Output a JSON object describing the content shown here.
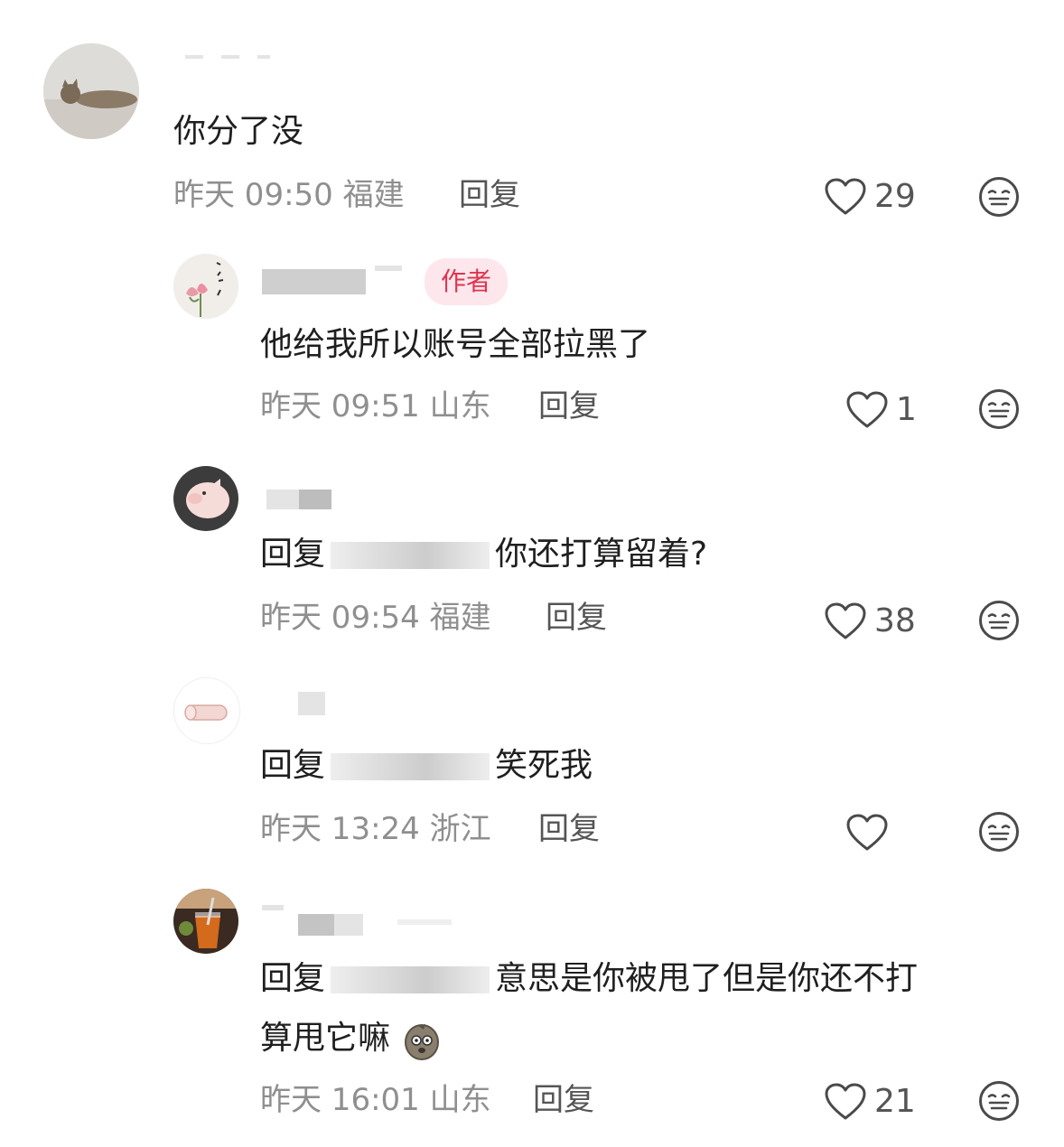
{
  "comments": [
    {
      "text": "你分了没",
      "meta": "昨天 09:50 福建",
      "reply_label": "回复",
      "likes": "29",
      "avatar_icon": "cat-avatar-icon"
    },
    {
      "author_tag": "作者",
      "text": "他给我所以账号全部拉黑了",
      "meta": "昨天 09:51 山东",
      "reply_label": "回复",
      "likes": "1",
      "avatar_icon": "flower-avatar-icon"
    },
    {
      "reply_prefix": "回复",
      "text": "你还打算留着?",
      "meta": "昨天 09:54 福建",
      "reply_label": "回复",
      "likes": "38",
      "avatar_icon": "pig-avatar-icon"
    },
    {
      "reply_prefix": "回复",
      "text": "笑死我",
      "meta": "昨天 13:24 浙江",
      "reply_label": "回复",
      "likes": "",
      "avatar_icon": "towel-avatar-icon"
    },
    {
      "reply_prefix": "回复",
      "text_line1": "意思是你被甩了但是你还不打",
      "text_line2": "算甩它嘛",
      "meta": "昨天 16:01 山东",
      "reply_label": "回复",
      "likes": "21",
      "avatar_icon": "drink-avatar-icon"
    }
  ]
}
